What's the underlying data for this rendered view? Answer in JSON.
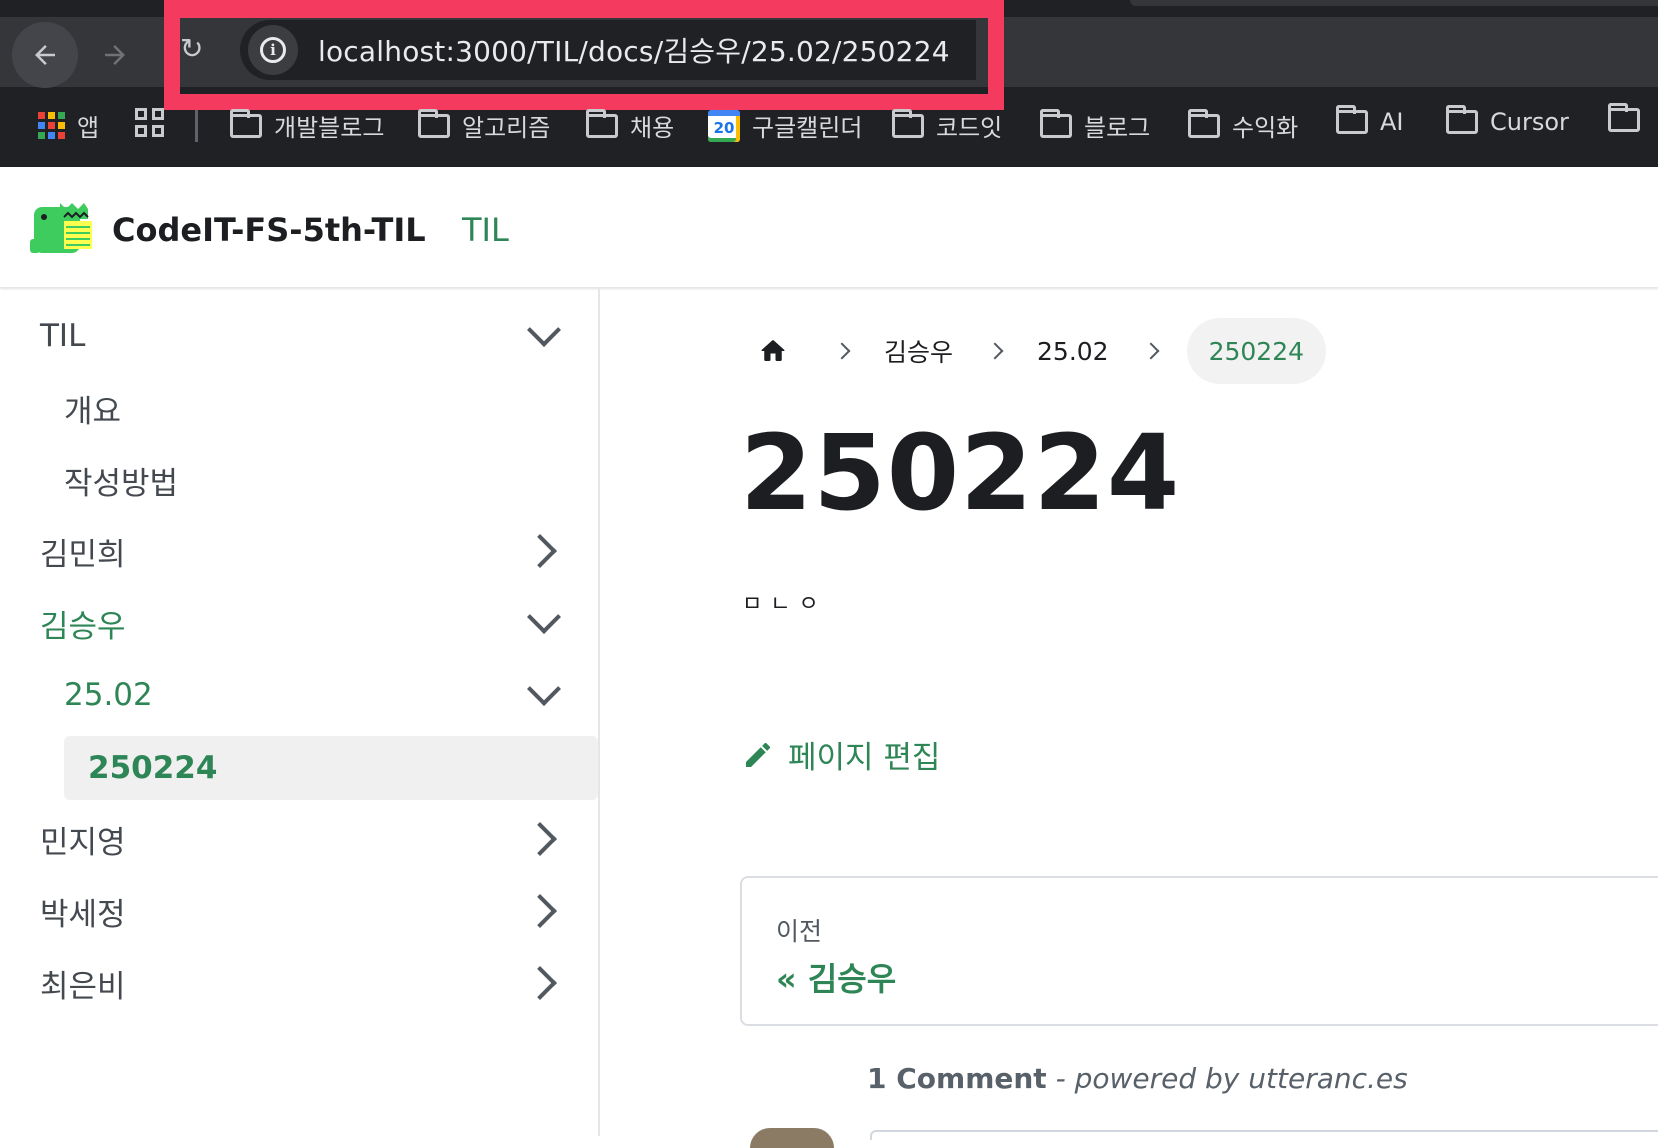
{
  "browser": {
    "url": "localhost:3000/TIL/docs/김승우/25.02/250224",
    "bookmarks": [
      {
        "label": "앱",
        "icon": "apps-grid-icon"
      },
      {
        "label": "",
        "icon": "tab-groups-icon"
      },
      {
        "label": "개발블로그",
        "icon": "folder-icon"
      },
      {
        "label": "알고리즘",
        "icon": "folder-icon"
      },
      {
        "label": "채용",
        "icon": "folder-icon"
      },
      {
        "label": "구글캘린더",
        "icon": "google-calendar-icon",
        "badge": "20"
      },
      {
        "label": "코드잇",
        "icon": "folder-icon"
      },
      {
        "label": "블로그",
        "icon": "folder-icon"
      },
      {
        "label": "수익화",
        "icon": "folder-icon"
      },
      {
        "label": "AI",
        "icon": "folder-icon"
      },
      {
        "label": "Cursor",
        "icon": "folder-icon"
      },
      {
        "label": "",
        "icon": "folder-icon"
      }
    ],
    "highlight_color": "#f43b5f"
  },
  "navbar": {
    "title": "CodeIT-FS-5th-TIL",
    "link": "TIL"
  },
  "sidebar": {
    "items": [
      {
        "label": "TIL",
        "state": "expanded"
      },
      {
        "label": "개요"
      },
      {
        "label": "작성방법"
      },
      {
        "label": "김민희",
        "state": "collapsed"
      },
      {
        "label": "김승우",
        "state": "expanded",
        "active": true
      },
      {
        "label": "25.02",
        "state": "expanded",
        "active": true
      },
      {
        "label": "250224",
        "active": true,
        "selected": true
      },
      {
        "label": "민지영",
        "state": "collapsed"
      },
      {
        "label": "박세정",
        "state": "collapsed"
      },
      {
        "label": "최은비",
        "state": "collapsed"
      }
    ]
  },
  "breadcrumb": {
    "items": [
      "김승우",
      "25.02"
    ],
    "current": "250224"
  },
  "doc": {
    "title": "250224",
    "body": "ㅁㄴㅇ",
    "edit_label": "페이지 편집"
  },
  "pager": {
    "sublabel": "이전",
    "label": "« 김승우"
  },
  "comments": {
    "count_label": "1 Comment",
    "powered_by": " - powered by utteranc.es"
  },
  "colors": {
    "accent": "#2e8555",
    "text": "#1c1e21",
    "chrome_bg": "#202124"
  }
}
